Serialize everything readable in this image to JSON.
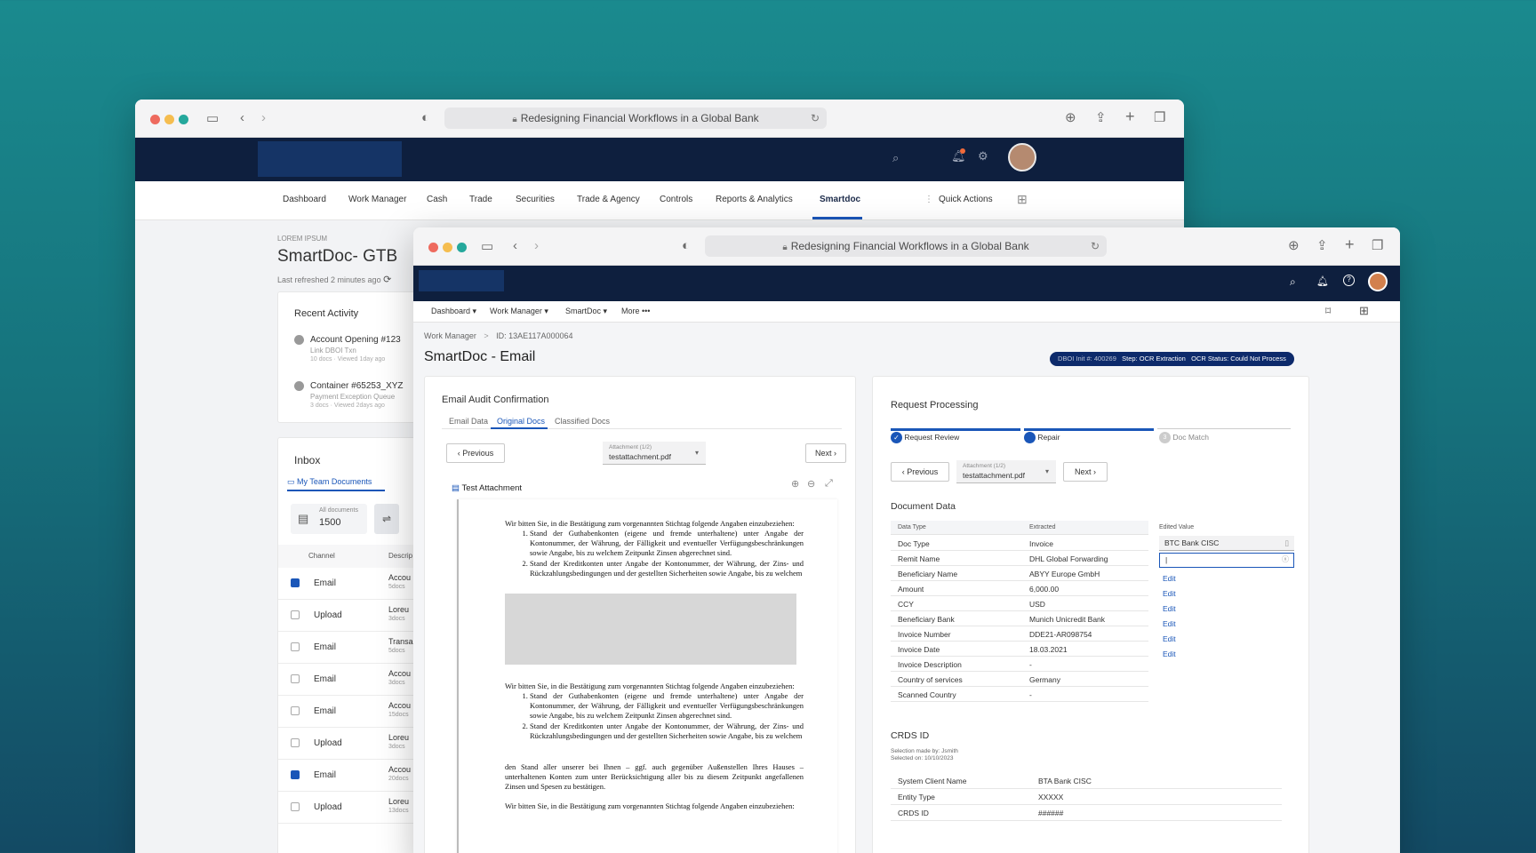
{
  "browser": {
    "url_text": "Redesigning Financial Workflows in a Global Bank"
  },
  "back_window": {
    "menu": [
      "Dashboard",
      "Work Manager",
      "Cash",
      "Trade",
      "Securities",
      "Trade & Agency",
      "Controls",
      "Reports & Analytics",
      "Smartdoc"
    ],
    "quick_actions": "Quick Actions",
    "eyebrow": "LOREM IPSUM",
    "title": "SmartDoc- GTB",
    "refreshed": "Last refreshed 2 minutes ago",
    "recent_activity": {
      "title": "Recent Activity",
      "items": [
        {
          "title": "Account Opening #123",
          "sub": "Link DBOI Txn",
          "meta": "10 docs · Viewed 1day ago"
        },
        {
          "title": "Container #65253_XYZ",
          "sub": "Payment Exception Queue",
          "meta": "3 docs · Viewed 2days ago"
        }
      ]
    },
    "inbox": {
      "title": "Inbox",
      "tab": "My Team Documents",
      "all_documents_label": "All documents",
      "all_documents_count": "1500",
      "col_channel": "Channel",
      "col_desc": "Descrip",
      "rows": [
        {
          "checked": true,
          "channel": "Email",
          "d1": "Accou",
          "d2": "5docs"
        },
        {
          "checked": false,
          "channel": "Upload",
          "d1": "Loreu",
          "d2": "3docs"
        },
        {
          "checked": false,
          "channel": "Email",
          "d1": "Transa",
          "d2": "5docs"
        },
        {
          "checked": false,
          "channel": "Email",
          "d1": "Accou",
          "d2": "3docs"
        },
        {
          "checked": false,
          "channel": "Email",
          "d1": "Accou",
          "d2": "15docs"
        },
        {
          "checked": false,
          "channel": "Upload",
          "d1": "Loreu",
          "d2": "3docs"
        },
        {
          "checked": true,
          "channel": "Email",
          "d1": "Accou",
          "d2": "20docs"
        },
        {
          "checked": false,
          "channel": "Upload",
          "d1": "Loreu",
          "d2": "13docs"
        }
      ]
    }
  },
  "front_window": {
    "menu": [
      "Dashboard ▾",
      "Work Manager ▾",
      "SmartDoc ▾",
      "More •••"
    ],
    "breadcrumb": {
      "root": "Work Manager",
      "sep": ">",
      "current": "ID: 13AE117A000064"
    },
    "title": "SmartDoc - Email",
    "status_pill": {
      "dboi": "DBOI Init #: 400269",
      "step": "Step: OCR Extraction",
      "ocr": "OCR Status: Could Not Process"
    },
    "left_panel": {
      "title": "Email Audit Confirmation",
      "tabs": [
        "Email Data",
        "Original Docs",
        "Classified Docs"
      ],
      "prev": "‹  Previous",
      "next": "Next  ›",
      "attachment_label": "Attachment (1/2)",
      "attachment_file": "testattachment.pdf",
      "doc_title": "Test Attachment",
      "doc": {
        "intro": "Wir bitten Sie, in die Bestätigung zum vorgenannten Stichtag folgende Angaben einzubeziehen:",
        "item1": "Stand der Guthabenkonten (eigene und fremde unterhaltene) unter Angabe der Kontonummer, der Währung, der Fälligkeit und eventueller Verfügungsbeschränkungen sowie Angabe, bis zu welchem Zeitpunkt Zinsen abgerechnet sind.",
        "item2": "Stand der Kreditkonten unter Angabe der Kontonummer, der Währung, der Zins- und Rückzahlungsbedingungen und der gestellten Sicherheiten sowie Angabe, bis zu welchem",
        "para": "den Stand aller unserer bei Ihnen – ggf. auch gegenüber Außenstellen Ihres Hauses – unterhaltenen Konten zum                 unter Berücksichtigung aller bis zu diesem Zeitpunkt angefallenen Zinsen und Spesen zu bestätigen."
      }
    },
    "right_panel": {
      "title": "Request Processing",
      "steps": [
        "Request Review",
        "Repair",
        "Doc Match"
      ],
      "step3_num": "3",
      "prev": "‹  Previous",
      "next": "Next  ›",
      "attachment_label": "Attachment (1/2)",
      "attachment_file": "testattachment.pdf",
      "doc_data_title": "Document Data",
      "col_type": "Data Type",
      "col_extracted": "Extracted",
      "col_edited": "Edited Value",
      "rows": [
        {
          "type": "Doc Type",
          "value": "Invoice"
        },
        {
          "type": "Remit Name",
          "value": "DHL Global Forwarding"
        },
        {
          "type": "Beneficiary Name",
          "value": "ABYY Europe GmbH"
        },
        {
          "type": "Amount",
          "value": "6,000.00"
        },
        {
          "type": "CCY",
          "value": "USD"
        },
        {
          "type": "Beneficiary Bank",
          "value": "Munich Unicredit Bank"
        },
        {
          "type": "Invoice Number",
          "value": "DDE21-AR098754"
        },
        {
          "type": "Invoice Date",
          "value": "18.03.2021"
        },
        {
          "type": "Invoice Description",
          "value": "-"
        },
        {
          "type": "Country of services",
          "value": "Germany"
        },
        {
          "type": "Scanned Country",
          "value": "-"
        }
      ],
      "edited_value_1": "BTC Bank CISC",
      "edited_value_2": "|",
      "edit_label": "Edit",
      "crds_title": "CRDS ID",
      "crds_sel1": "Selection made by: Jsmith",
      "crds_sel2": "Selected on: 10/10/2023",
      "crds_rows": [
        {
          "k": "System Client Name",
          "v": "BTA Bank CISC"
        },
        {
          "k": "Entity Type",
          "v": "XXXXX"
        },
        {
          "k": "CRDS ID",
          "v": "######"
        }
      ]
    }
  }
}
